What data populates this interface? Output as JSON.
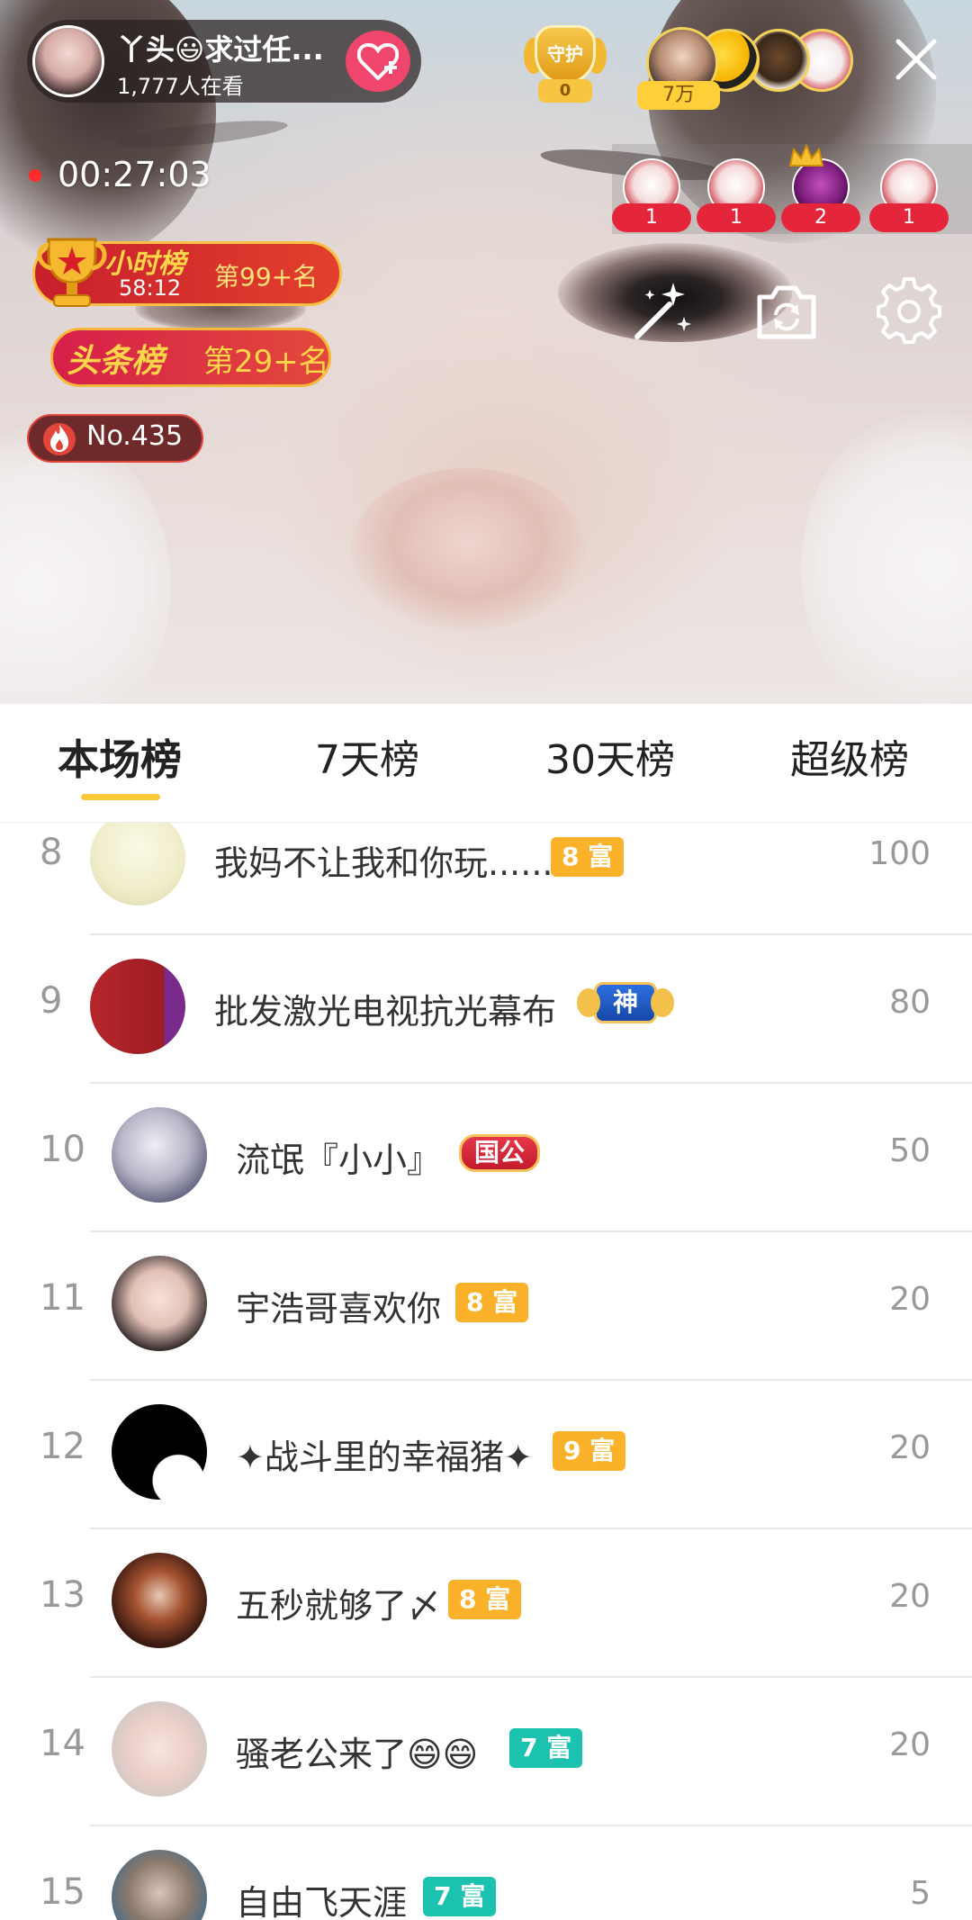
{
  "host": {
    "name": "丫头😃求过任...",
    "viewers": "1,777人在看"
  },
  "guard": {
    "label": "守护",
    "count": "0"
  },
  "top_fans_count": "7万",
  "timer": "00:27:03",
  "mini_gifts": [
    "1",
    "1",
    "2",
    "1"
  ],
  "hour_rank": {
    "title": "小时榜",
    "time": "58:12",
    "rank": "第99+名"
  },
  "headline_rank": {
    "title": "头条榜",
    "rank": "第29+名"
  },
  "popularity": "No.435",
  "tabs": [
    "本场榜",
    "7天榜",
    "30天榜",
    "超级榜"
  ],
  "active_tab": "本场榜",
  "colors": {
    "accent": "#fcc93a",
    "follow": "#f0466d",
    "rich_gold": "#fbb22a",
    "rich_teal": "#1bc2b0"
  },
  "ranking": [
    {
      "rank": "8",
      "name": "我妈不让我和你玩......",
      "badge": "8 富",
      "badge_style": "gold",
      "points": "100"
    },
    {
      "rank": "9",
      "name": "批发激光电视抗光幕布",
      "badge": "神",
      "badge_style": "god",
      "points": "80"
    },
    {
      "rank": "10",
      "name": "流氓『小小』",
      "badge": "国公",
      "badge_style": "noble",
      "points": "50"
    },
    {
      "rank": "11",
      "name": "宇浩哥喜欢你",
      "badge": "8 富",
      "badge_style": "gold",
      "points": "20"
    },
    {
      "rank": "12",
      "name": "✦战斗里的幸福猪✦",
      "badge": "9 富",
      "badge_style": "gold",
      "points": "20"
    },
    {
      "rank": "13",
      "name": "五秒就够了〆",
      "badge": "8 富",
      "badge_style": "gold",
      "points": "20"
    },
    {
      "rank": "14",
      "name": "骚老公来了😄😄",
      "badge": "7 富",
      "badge_style": "teal",
      "points": "20"
    },
    {
      "rank": "15",
      "name": "自由飞天涯",
      "badge": "7 富",
      "badge_style": "teal",
      "points": "5"
    }
  ]
}
